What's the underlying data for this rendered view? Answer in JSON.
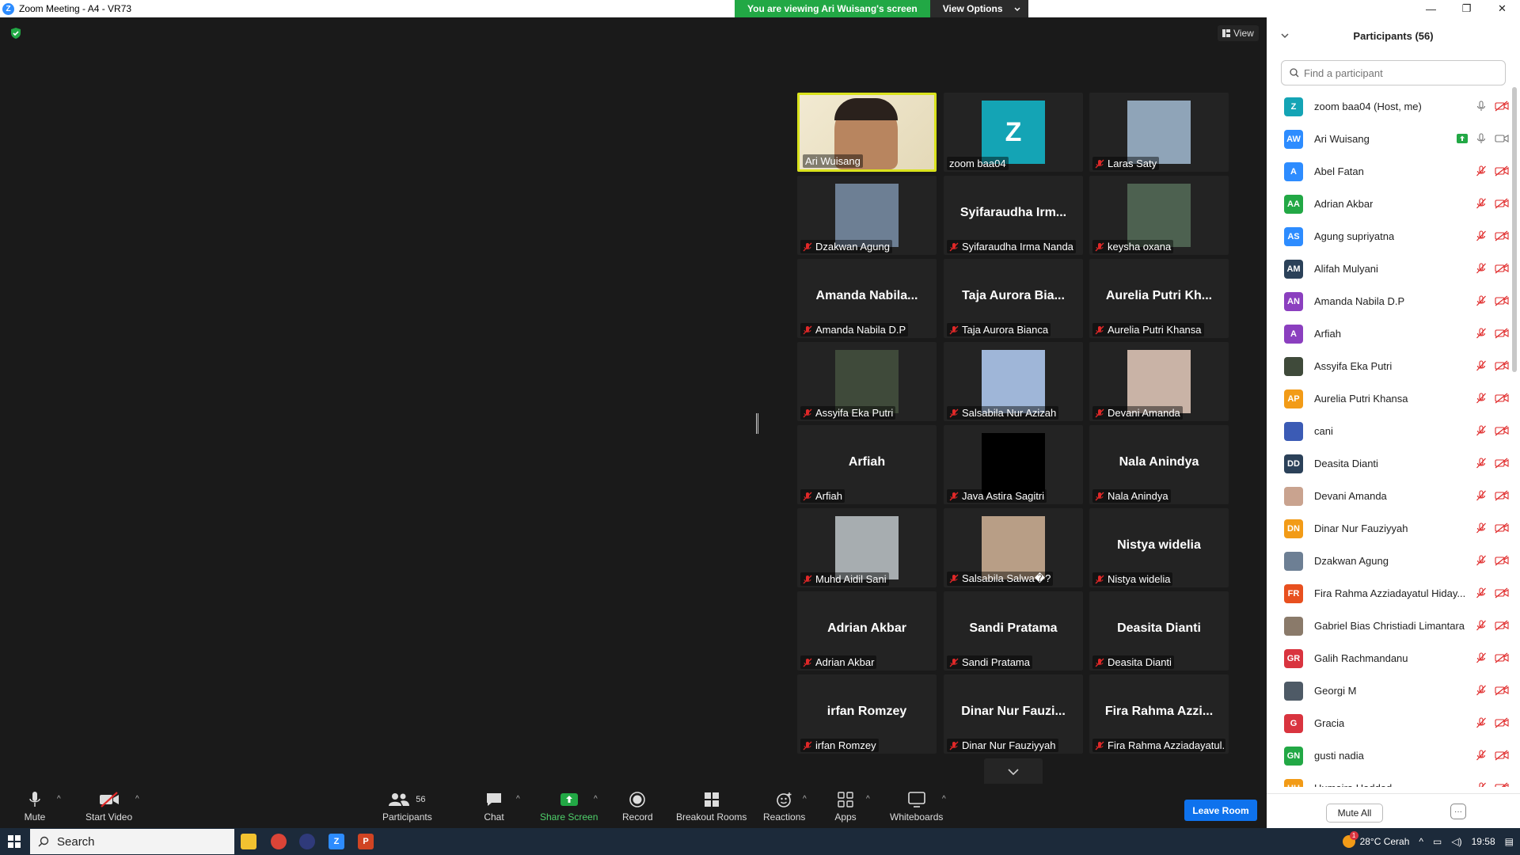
{
  "window": {
    "title": "Zoom Meeting - A4 - VR73",
    "logo_letter": "Z",
    "controls": [
      "—",
      "❐",
      "✕"
    ]
  },
  "banner": {
    "message": "You are viewing Ari Wuisang's screen",
    "options_label": "View Options"
  },
  "stage": {
    "view_label": "View"
  },
  "gallery": [
    {
      "big": "",
      "label": "Ari Wuisang",
      "kind": "video-face",
      "active": true,
      "muted": false
    },
    {
      "big": "",
      "label": "zoom baa04",
      "kind": "avatar-z",
      "avatar": "Z",
      "active": false,
      "muted": false
    },
    {
      "big": "",
      "label": "Laras Saty",
      "kind": "photo",
      "photo": "#8fa4b8",
      "active": false,
      "muted": true
    },
    {
      "big": "",
      "label": "Dzakwan Agung",
      "kind": "photo",
      "photo": "#6d7f94",
      "active": false,
      "muted": true
    },
    {
      "big": "Syifaraudha  Irm...",
      "label": "Syifaraudha Irma Nanda",
      "kind": "name",
      "active": false,
      "muted": true
    },
    {
      "big": "",
      "label": "keysha oxana",
      "kind": "photo",
      "photo": "#4d6150",
      "active": false,
      "muted": true
    },
    {
      "big": "Amanda  Nabila...",
      "label": "Amanda Nabila D.P",
      "kind": "name",
      "active": false,
      "muted": true
    },
    {
      "big": "Taja Aurora Bia...",
      "label": "Taja Aurora Bianca",
      "kind": "name",
      "active": false,
      "muted": true
    },
    {
      "big": "Aurelia Putri Kh...",
      "label": "Aurelia Putri Khansa",
      "kind": "name",
      "active": false,
      "muted": true
    },
    {
      "big": "",
      "label": "Assyifa Eka Putri",
      "kind": "photo",
      "photo": "#3f4a3a",
      "active": false,
      "muted": true
    },
    {
      "big": "",
      "label": "Salsabila Nur Azizah",
      "kind": "photo",
      "photo": "#9fb6d8",
      "active": false,
      "muted": true
    },
    {
      "big": "",
      "label": "Devani Amanda",
      "kind": "photo",
      "photo": "#c9b3a6",
      "active": false,
      "muted": true
    },
    {
      "big": "Arfiah",
      "label": "Arfiah",
      "kind": "name",
      "active": false,
      "muted": true
    },
    {
      "big": "",
      "label": "Java Astira Sagitri",
      "kind": "photo",
      "photo": "#000000",
      "active": false,
      "muted": true
    },
    {
      "big": "Nala Anindya",
      "label": "Nala Anindya",
      "kind": "name",
      "active": false,
      "muted": true
    },
    {
      "big": "",
      "label": "Muhd Aidil Sani",
      "kind": "photo",
      "photo": "#a7adb0",
      "active": false,
      "muted": true
    },
    {
      "big": "",
      "label": "Salsabila Salwa�?",
      "kind": "photo",
      "photo": "#b89e86",
      "active": false,
      "muted": true
    },
    {
      "big": "Nistya widelia",
      "label": "Nistya widelia",
      "kind": "name",
      "active": false,
      "muted": true
    },
    {
      "big": "Adrian Akbar",
      "label": "Adrian Akbar",
      "kind": "name",
      "active": false,
      "muted": true
    },
    {
      "big": "Sandi Pratama",
      "label": "Sandi Pratama",
      "kind": "name",
      "active": false,
      "muted": true
    },
    {
      "big": "Deasita Dianti",
      "label": "Deasita Dianti",
      "kind": "name",
      "active": false,
      "muted": true
    },
    {
      "big": "irfan Romzey",
      "label": "irfan Romzey",
      "kind": "name",
      "active": false,
      "muted": true
    },
    {
      "big": "Dinar Nur Fauzi...",
      "label": "Dinar Nur Fauziyyah",
      "kind": "name",
      "active": false,
      "muted": true
    },
    {
      "big": "Fira Rahma Azzi...",
      "label": "Fira Rahma Azziadayatul...",
      "kind": "name",
      "active": false,
      "muted": true
    }
  ],
  "toolbar": {
    "mute": "Mute",
    "start_video": "Start Video",
    "participants": "Participants",
    "participants_count": "56",
    "chat": "Chat",
    "share_screen": "Share Screen",
    "record": "Record",
    "breakout_rooms": "Breakout Rooms",
    "reactions": "Reactions",
    "apps": "Apps",
    "whiteboards": "Whiteboards",
    "leave": "Leave Room"
  },
  "panel": {
    "title": "Participants (56)",
    "search_placeholder": "Find a participant",
    "mute_all": "Mute All",
    "participants": [
      {
        "initials": "Z",
        "name": "zoom baa04 (Host, me)",
        "color": "#14a4b5",
        "state": "host"
      },
      {
        "initials": "AW",
        "name": "Ari Wuisang",
        "color": "#2d8cff",
        "state": "sharing"
      },
      {
        "initials": "A",
        "name": "Abel Fatan",
        "color": "#2d8cff",
        "state": "muted"
      },
      {
        "initials": "AA",
        "name": "Adrian Akbar",
        "color": "#22a845",
        "state": "muted"
      },
      {
        "initials": "AS",
        "name": "Agung supriyatna",
        "color": "#2d8cff",
        "state": "muted"
      },
      {
        "initials": "AM",
        "name": "Alifah Mulyani",
        "color": "#2b4159",
        "state": "muted"
      },
      {
        "initials": "AN",
        "name": "Amanda Nabila D.P",
        "color": "#8b3fbf",
        "state": "muted"
      },
      {
        "initials": "A",
        "name": "Arfiah",
        "color": "#8b3fbf",
        "state": "muted"
      },
      {
        "initials": "",
        "name": "Assyifa Eka Putri",
        "color": "#3f4a3a",
        "state": "muted"
      },
      {
        "initials": "AP",
        "name": "Aurelia Putri Khansa",
        "color": "#f29b17",
        "state": "muted"
      },
      {
        "initials": "",
        "name": "cani",
        "color": "#3b5bb5",
        "state": "muted"
      },
      {
        "initials": "DD",
        "name": "Deasita Dianti",
        "color": "#2b4159",
        "state": "muted"
      },
      {
        "initials": "",
        "name": "Devani Amanda",
        "color": "#c9a38f",
        "state": "muted"
      },
      {
        "initials": "DN",
        "name": "Dinar Nur Fauziyyah",
        "color": "#f29b17",
        "state": "muted"
      },
      {
        "initials": "",
        "name": "Dzakwan Agung",
        "color": "#6d7f94",
        "state": "muted"
      },
      {
        "initials": "FR",
        "name": "Fira Rahma Azziadayatul Hiday...",
        "color": "#e8501f",
        "state": "muted"
      },
      {
        "initials": "",
        "name": "Gabriel Bias Christiadi Limantara",
        "color": "#8a7a6a",
        "state": "muted"
      },
      {
        "initials": "GR",
        "name": "Galih Rachmandanu",
        "color": "#d9343f",
        "state": "muted"
      },
      {
        "initials": "",
        "name": "Georgi M",
        "color": "#4e5a66",
        "state": "muted"
      },
      {
        "initials": "G",
        "name": "Gracia",
        "color": "#d9343f",
        "state": "muted"
      },
      {
        "initials": "GN",
        "name": "gusti nadia",
        "color": "#22a845",
        "state": "muted"
      },
      {
        "initials": "HH",
        "name": "Humaira Haddad",
        "color": "#f29b17",
        "state": "muted"
      }
    ]
  },
  "taskbar": {
    "search_label": "Search",
    "weather": "28°C  Cerah",
    "time": "19:58",
    "notification_count": "1"
  }
}
